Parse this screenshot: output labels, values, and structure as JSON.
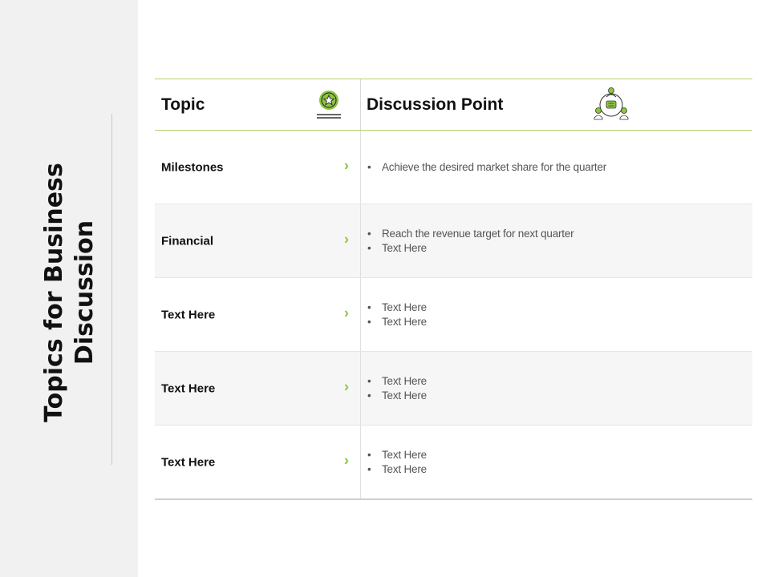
{
  "slide": {
    "title": "Topics for Business Discussion"
  },
  "table": {
    "header": {
      "topic": "Topic",
      "discussion": "Discussion Point",
      "topic_icon": "star-badge-icon",
      "discussion_icon": "team-discussion-icon"
    },
    "accent_color": "#8cc63f",
    "rows": [
      {
        "topic": "Milestones",
        "points": [
          "Achieve the desired market share for the quarter"
        ]
      },
      {
        "topic": "Financial",
        "points": [
          "Reach the revenue target for next quarter",
          "Text Here"
        ]
      },
      {
        "topic": "Text Here",
        "points": [
          "Text Here",
          "Text Here"
        ]
      },
      {
        "topic": "Text Here",
        "points": [
          "Text Here",
          "Text Here"
        ]
      },
      {
        "topic": "Text Here",
        "points": [
          "Text Here",
          "Text Here"
        ]
      }
    ]
  }
}
